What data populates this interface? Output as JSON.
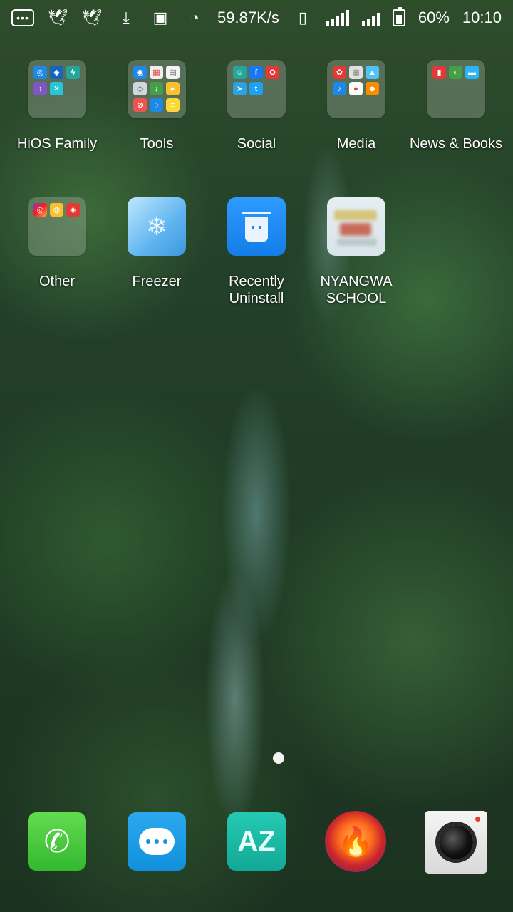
{
  "statusbar": {
    "network_speed": "59.87K/s",
    "battery": "60%",
    "time": "10:10",
    "left_icons": [
      "more-icon",
      "bird-icon",
      "bird-icon",
      "download-icon",
      "image-icon",
      "timer-icon"
    ],
    "right_icons": [
      "vibrate-icon",
      "signal-icon",
      "signal-icon",
      "battery-icon"
    ]
  },
  "home": {
    "row1": [
      {
        "label": "HiOS Family"
      },
      {
        "label": "Tools"
      },
      {
        "label": "Social"
      },
      {
        "label": "Media"
      },
      {
        "label": "News & Books"
      }
    ],
    "row2": [
      {
        "label": "Other"
      },
      {
        "label": "Freezer"
      },
      {
        "label": "Recently\nUninstall"
      },
      {
        "label": "NYANGWA\nSCHOOL"
      }
    ]
  },
  "dock": {
    "apps": [
      "phone-icon",
      "messages-icon",
      "az-icon",
      "phoenix-browser-icon",
      "camera-icon"
    ]
  },
  "colors": {
    "folder_bg": "#c8d2c8",
    "phone": "#33b830",
    "messages": "#1190dc",
    "az": "#12a996",
    "uninstall": "#137de9"
  }
}
